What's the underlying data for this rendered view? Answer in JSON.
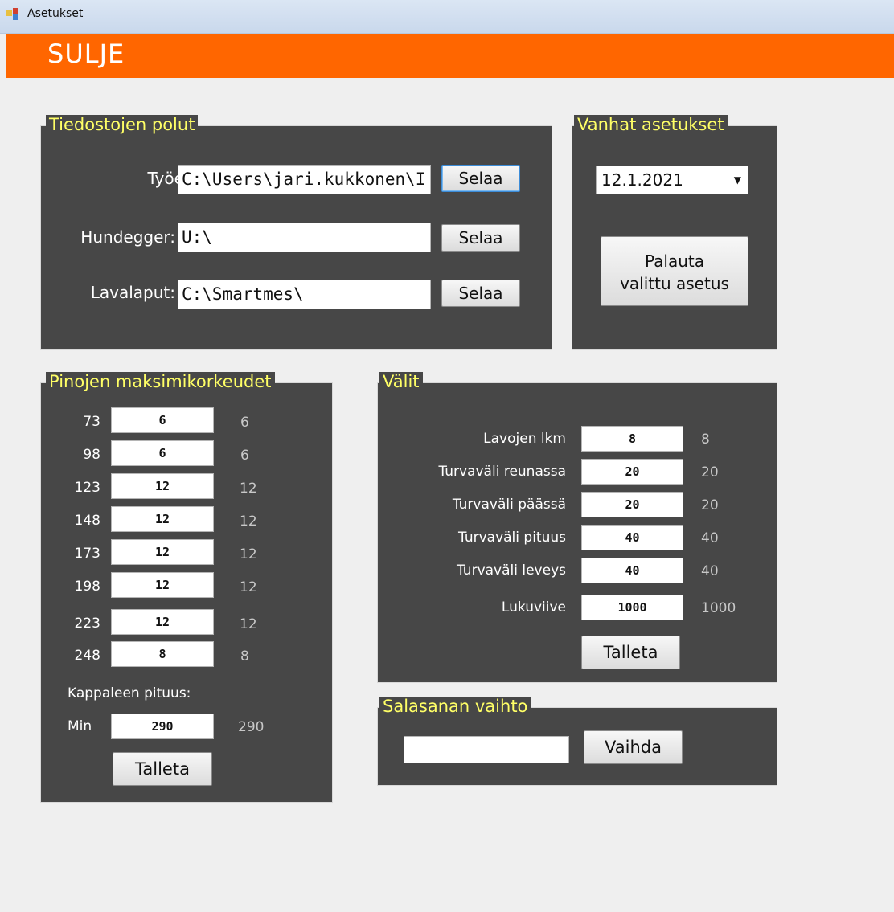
{
  "window": {
    "title": "Asetukset"
  },
  "header": {
    "close_label": "SULJE"
  },
  "paths": {
    "legend": "Tiedostojen polut",
    "rows": [
      {
        "label": "Työerät:",
        "value": "C:\\Users\\jari.kukkonen\\I",
        "button": "Selaa"
      },
      {
        "label": "Hundegger:",
        "value": "U:\\",
        "button": "Selaa"
      },
      {
        "label": "Lavalaput:",
        "value": "C:\\Smartmes\\",
        "button": "Selaa"
      }
    ]
  },
  "old_settings": {
    "legend": "Vanhat asetukset",
    "selected": "12.1.2021",
    "restore_line1": "Palauta",
    "restore_line2": "valittu asetus"
  },
  "stacks": {
    "legend": "Pinojen maksimikorkeudet",
    "rows": [
      {
        "label": "73",
        "input": "6",
        "current": "6"
      },
      {
        "label": "98",
        "input": "6",
        "current": "6"
      },
      {
        "label": "123",
        "input": "12",
        "current": "12"
      },
      {
        "label": "148",
        "input": "12",
        "current": "12"
      },
      {
        "label": "173",
        "input": "12",
        "current": "12"
      },
      {
        "label": "198",
        "input": "12",
        "current": "12"
      },
      {
        "label": "223",
        "input": "12",
        "current": "12"
      },
      {
        "label": "248",
        "input": "8",
        "current": "8"
      }
    ],
    "piece_length_label": "Kappaleen pituus:",
    "min_label": "Min",
    "min_input": "290",
    "min_current": "290",
    "save_label": "Talleta"
  },
  "gaps": {
    "legend": "Välit",
    "rows": [
      {
        "label": "Lavojen lkm",
        "input": "8",
        "current": "8"
      },
      {
        "label": "Turvaväli reunassa",
        "input": "20",
        "current": "20"
      },
      {
        "label": "Turvaväli päässä",
        "input": "20",
        "current": "20"
      },
      {
        "label": "Turvaväli pituus",
        "input": "40",
        "current": "40"
      },
      {
        "label": "Turvaväli leveys",
        "input": "40",
        "current": "40"
      },
      {
        "label": "Lukuviive",
        "input": "1000",
        "current": "1000"
      }
    ],
    "save_label": "Talleta"
  },
  "password": {
    "legend": "Salasanan vaihto",
    "value": "",
    "change_label": "Vaihda"
  }
}
